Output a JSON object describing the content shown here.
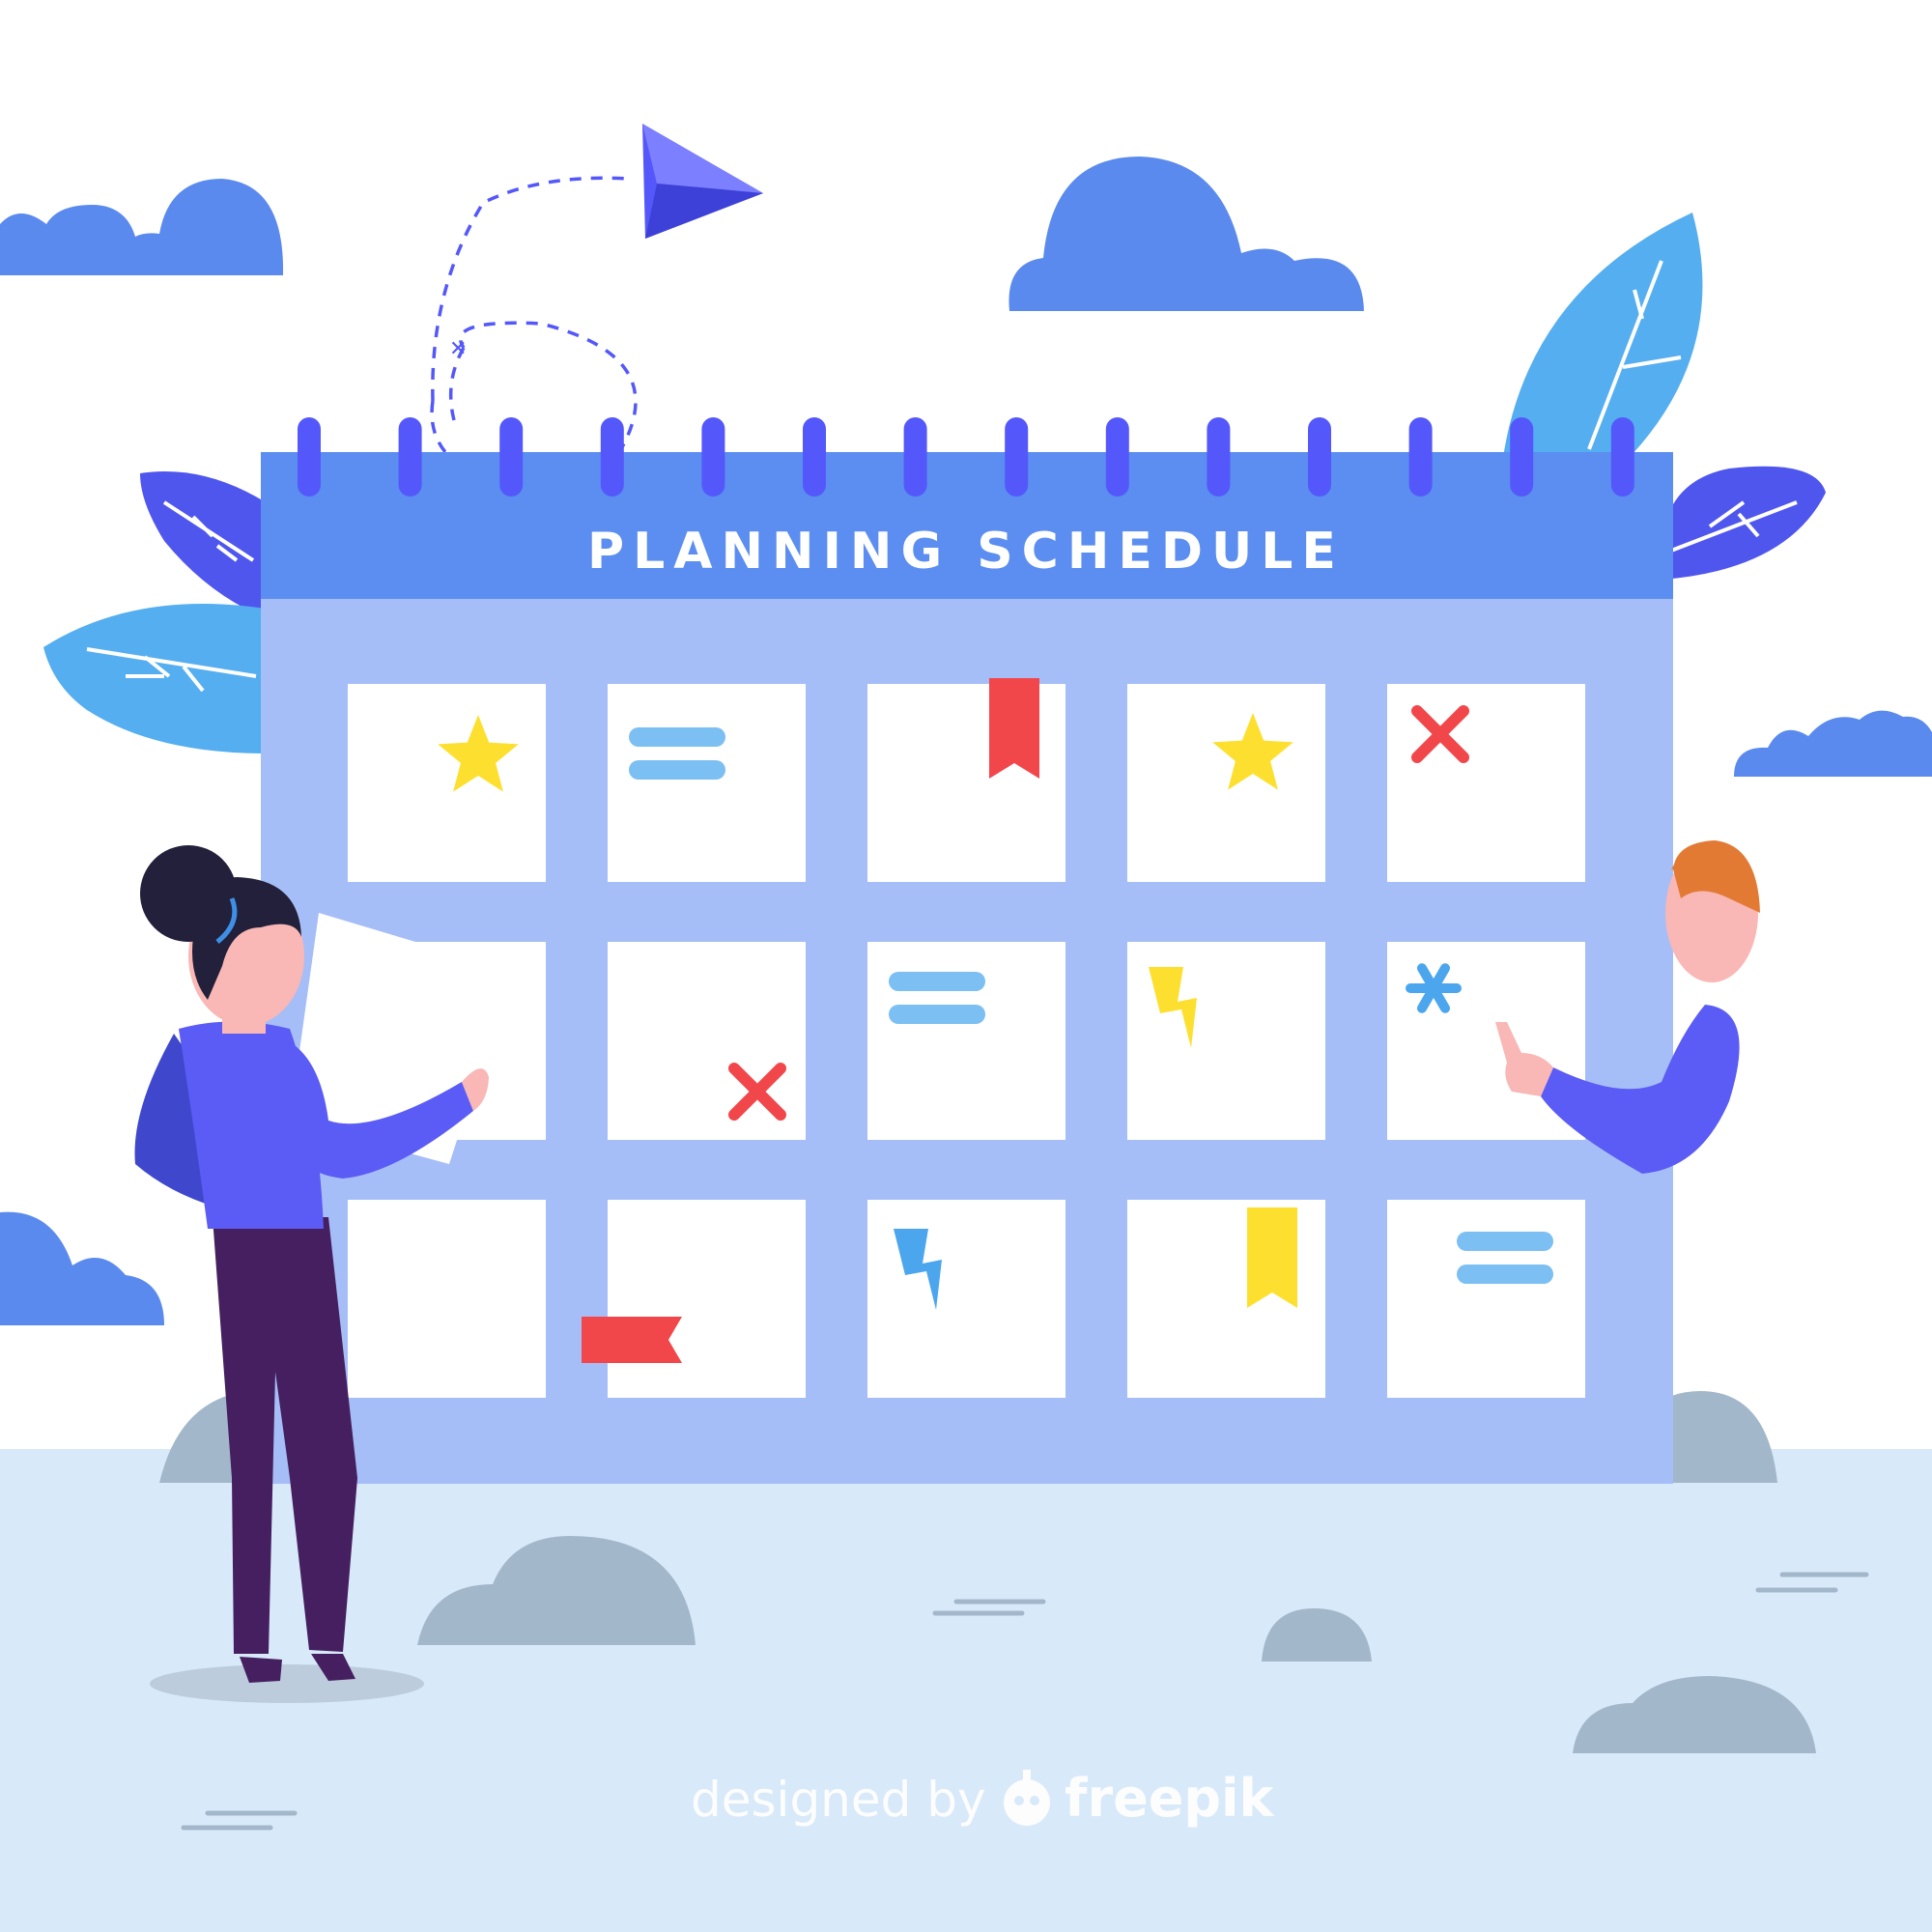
{
  "calendar": {
    "title": "PLANNING SCHEDULE",
    "ring_count": 14,
    "cells": [
      {
        "row": 1,
        "col": 1,
        "marker": "star-icon",
        "color": "#FDE02F"
      },
      {
        "row": 1,
        "col": 2,
        "marker": "equals-lines-icon",
        "color": "#7CBFF3"
      },
      {
        "row": 1,
        "col": 3,
        "marker": "bookmark-icon",
        "color": "#F2474A"
      },
      {
        "row": 1,
        "col": 4,
        "marker": "star-icon",
        "color": "#FDE02F"
      },
      {
        "row": 1,
        "col": 5,
        "marker": "cross-icon",
        "color": "#F2474A"
      },
      {
        "row": 2,
        "col": 1,
        "marker": "none",
        "color": "#FFFFFF"
      },
      {
        "row": 2,
        "col": 2,
        "marker": "cross-icon",
        "color": "#F2474A"
      },
      {
        "row": 2,
        "col": 3,
        "marker": "equals-lines-icon",
        "color": "#7CBFF3"
      },
      {
        "row": 2,
        "col": 4,
        "marker": "lightning-icon",
        "color": "#FDE02F"
      },
      {
        "row": 2,
        "col": 5,
        "marker": "asterisk-icon",
        "color": "#4BA6EE"
      },
      {
        "row": 3,
        "col": 1,
        "marker": "none",
        "color": "#FFFFFF"
      },
      {
        "row": 3,
        "col": 2,
        "marker": "ribbon-tag-icon",
        "color": "#F2474A"
      },
      {
        "row": 3,
        "col": 3,
        "marker": "lightning-icon",
        "color": "#4BA6EE"
      },
      {
        "row": 3,
        "col": 4,
        "marker": "bookmark-icon",
        "color": "#FDE02F"
      },
      {
        "row": 3,
        "col": 5,
        "marker": "equals-lines-icon",
        "color": "#7CBFF3"
      }
    ]
  },
  "credit": {
    "prefix": "designed by",
    "brand": "freepik"
  },
  "colors": {
    "calendar_header": "#5B8EF0",
    "calendar_body": "#A6BEF7",
    "ring": "#5458FB",
    "cloud": "#5B8AEE",
    "leaf_light": "#55AEF0",
    "leaf_dark": "#4F56EE",
    "ground": "#D8E9FA",
    "rock": "#A3B7CB",
    "paper_plane": "#5458FB",
    "woman_top": "#5B5BF5",
    "woman_pants": "#451F5F",
    "woman_hair": "#22203A",
    "man_hair": "#E27A34",
    "skin": "#F9B7B5"
  }
}
